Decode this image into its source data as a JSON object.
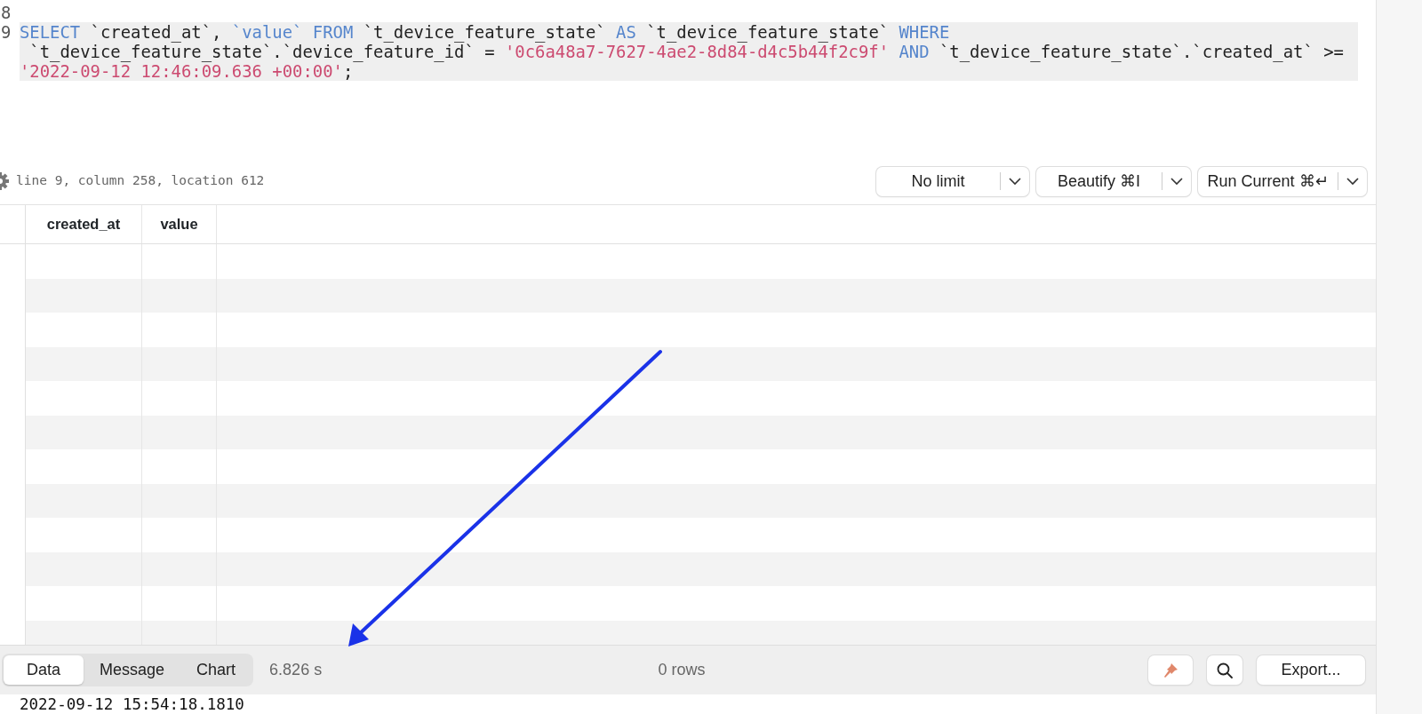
{
  "editor": {
    "lines": [
      {
        "number": "8",
        "highlighted": false
      },
      {
        "number": "9",
        "highlighted": true,
        "rows": [
          {
            "tokens": [
              {
                "kind": "keyword",
                "text": "SELECT"
              },
              {
                "kind": "plain",
                "text": " `created_at`, "
              },
              {
                "kind": "keyword",
                "text": "`value` FROM"
              },
              {
                "kind": "plain",
                "text": " `t_device_feature_state` "
              },
              {
                "kind": "keyword",
                "text": "AS"
              },
              {
                "kind": "plain",
                "text": " `t_device_feature_state` "
              },
              {
                "kind": "keyword",
                "text": "WHERE"
              }
            ]
          },
          {
            "tokens": [
              {
                "kind": "plain",
                "text": " `t_device_feature_state`.`device_feature_id` = "
              },
              {
                "kind": "string",
                "text": "'0c6a48a7-7627-4ae2-8d84-d4c5b44f2c9f'"
              },
              {
                "kind": "keyword",
                "text": " AND"
              },
              {
                "kind": "plain",
                "text": " `t_device_feature_state`.`created_at` >="
              }
            ]
          },
          {
            "tokens": [
              {
                "kind": "string",
                "text": "'2022-09-12 12:46:09.636 +00:00'"
              },
              {
                "kind": "plain",
                "text": ";"
              }
            ]
          }
        ]
      }
    ]
  },
  "status": "line 9, column 258, location 612",
  "toolbar": {
    "buttons": [
      {
        "label": "No limit"
      },
      {
        "label": "Beautify ⌘I"
      },
      {
        "label": "Run Current ⌘↵"
      }
    ]
  },
  "grid": {
    "columns": [
      "created_at",
      "value"
    ]
  },
  "result_bar": {
    "tabs": [
      {
        "label": "Data",
        "selected": true
      },
      {
        "label": "Message",
        "selected": false
      },
      {
        "label": "Chart",
        "selected": false
      }
    ],
    "elapsed": "6.826 s",
    "row_count": "0 rows",
    "export_label": "Export..."
  },
  "log_line": "2022-09-12 15:54:18.1810"
}
